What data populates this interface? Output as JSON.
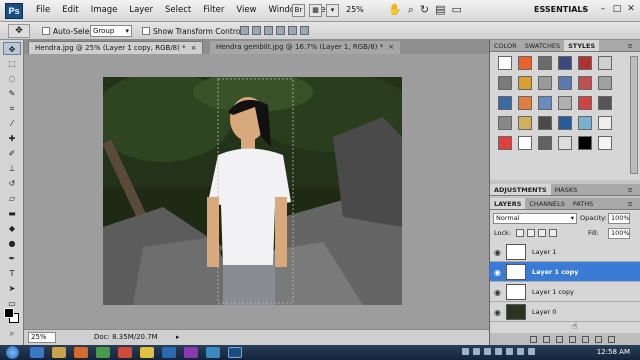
{
  "menubar": {
    "logo": "Ps",
    "items": [
      "File",
      "Edit",
      "Image",
      "Layer",
      "Select",
      "Filter",
      "View",
      "Window",
      "Help"
    ],
    "zoom": "25%",
    "workspace": "ESSENTIALS",
    "window_buttons": [
      "–",
      "□",
      "✕"
    ]
  },
  "options": {
    "auto_select_label": "Auto-Select:",
    "auto_select_value": "Group",
    "show_transform_label": "Show Transform Controls"
  },
  "tabs": [
    {
      "label": "Hendra.jpg @ 25% (Layer 1 copy, RGB/8) *",
      "close": "×"
    },
    {
      "label": "Hendra gemblit.jpg @ 16.7% (Layer 1, RGB/8) *",
      "close": "×"
    }
  ],
  "status": {
    "zoom": "25%",
    "doc": "Doc: 8.35M/20.7M",
    "arrow": "▸"
  },
  "panels": {
    "top_tabs": [
      "COLOR",
      "SWATCHES",
      "STYLES"
    ],
    "adjust_tabs": [
      "ADJUSTMENTS",
      "MASKS"
    ],
    "layer_tabs": [
      "LAYERS",
      "CHANNELS",
      "PATHS"
    ],
    "blend_mode": "Normal",
    "opacity_label": "Opacity:",
    "opacity_value": "100%",
    "lock_label": "Lock:",
    "fill_label": "Fill:",
    "fill_value": "100%",
    "menu_icon": "≡",
    "layers": [
      {
        "name": "Layer 1",
        "selected": false
      },
      {
        "name": "Layer 1 copy",
        "selected": true
      },
      {
        "name": "Layer 1 copy",
        "selected": false
      },
      {
        "name": "Layer 0",
        "selected": false
      }
    ]
  },
  "style_swatch_colors": [
    "#ffffff",
    "#e8622a",
    "#6b6b6b",
    "#3a4a7a",
    "#b03030",
    "#d0d0d0",
    "#7a7a7a",
    "#d8a030",
    "#9a9a9a",
    "#5a7ab0",
    "#c05050",
    "#a0a0a0",
    "#3a6aa0",
    "#e08040",
    "#6a8ac0",
    "#b0b0b0",
    "#cc4444",
    "#555555",
    "#888888",
    "#d0b060",
    "#4a4a4a",
    "#2a5a9a",
    "#7ab0d0",
    "#eeeeee",
    "#e04040",
    "#ffffff",
    "#606060",
    "#dddddd",
    "#000000",
    "#f4f4f4"
  ],
  "taskbar": {
    "clock": "12:58 AM"
  }
}
